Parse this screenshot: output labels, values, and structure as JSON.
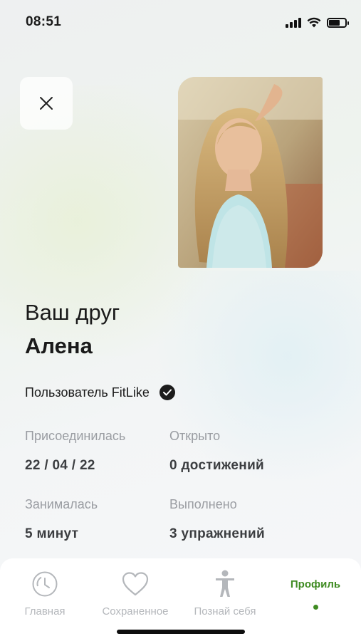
{
  "status_bar": {
    "time": "08:51"
  },
  "profile": {
    "title_prefix": "Ваш друг",
    "name": "Алена",
    "user_type": "Пользователь FitLike"
  },
  "stats": [
    {
      "label": "Присоединилась",
      "value": "22 / 04 / 22"
    },
    {
      "label": "Открыто",
      "value": "0 достижений"
    },
    {
      "label": "Занималась",
      "value": "5 минут"
    },
    {
      "label": "Выполнено",
      "value": "3 упражнений"
    }
  ],
  "bottom_nav": {
    "items": [
      {
        "label": "Главная",
        "icon": "clock-icon"
      },
      {
        "label": "Сохраненное",
        "icon": "heart-icon"
      },
      {
        "label": "Познай себя",
        "icon": "person-icon"
      },
      {
        "label": "Профиль",
        "icon": "active-dot"
      }
    ],
    "active_index": 3
  },
  "colors": {
    "accent": "#3f8b22",
    "muted_text": "#9a9da2",
    "nav_inactive": "#b4b7bb"
  }
}
